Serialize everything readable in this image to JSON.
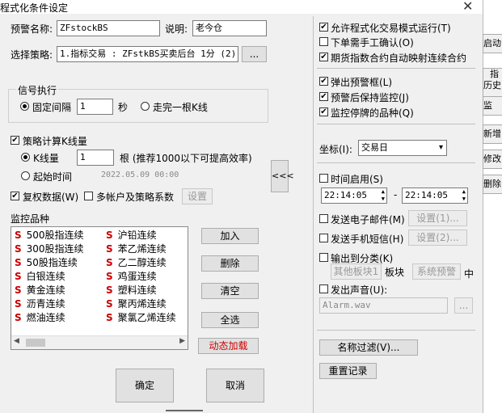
{
  "window": {
    "title": "程式化条件设定",
    "close_symbol": "✕"
  },
  "fields": {
    "alert_name_label": "预警名称:",
    "alert_name_value": "ZFstockBS",
    "desc_label": "说明:",
    "desc_value": "老今仓",
    "strategy_label": "选择策略:",
    "strategy_value": "1.指标交易 : ZFstkBS买卖后台 1分 (2)",
    "strategy_browse": "..."
  },
  "signal": {
    "group_label": "信号执行",
    "fixed_interval_label": "固定间隔",
    "fixed_interval_value": "1",
    "seconds_unit": "秒",
    "bar_complete_label": "走完一根K线"
  },
  "calc": {
    "strategy_kbars_label": "策略计算K线量",
    "kbars_label": "K线量",
    "kbars_value": "1",
    "kbars_hint": "根 (推荐1000以下可提高效率)",
    "start_time_label": "起始时间",
    "start_time_value": "2022.05.09 00:00:00",
    "adjusted_data_label": "复权数据(W)",
    "multi_account_label": "多帐户及策略系数",
    "settings_button": "设置"
  },
  "collapse_button": "<<<",
  "monitor": {
    "label": "监控品种",
    "s_marker": "S",
    "items_left": [
      "500股指连续",
      "300股指连续",
      "50股指连续",
      "白银连续",
      "黄金连续",
      "沥青连续",
      "燃油连续"
    ],
    "items_right": [
      "沪铅连续",
      "苯乙烯连续",
      "乙二醇连续",
      "鸡蛋连续",
      "塑料连续",
      "聚丙烯连续",
      "聚氯乙烯连续"
    ],
    "add_button": "加入",
    "delete_button": "删除",
    "clear_button": "清空",
    "select_all_button": "全选",
    "dynamic_load_button": "动态加载",
    "scroll_left": "◀",
    "scroll_right": "▶"
  },
  "bottom": {
    "ok_button": "确定",
    "cancel_button": "取消"
  },
  "right": {
    "allow_auto_trade": "允许程式化交易模式运行(T)",
    "manual_confirm": "下单需手工确认(O)",
    "futures_map": "期货指数合约自动映射连续合约",
    "popup_alert": "弹出预警框(L)",
    "keep_monitor": "预警后保持监控(J)",
    "monitor_suspended": "监控停牌的品种(Q)",
    "coord_label": "坐标(I):",
    "coord_value": "交易日",
    "time_enable": "时间启用(S)",
    "time_from": "22:14:05",
    "time_to": "22:14:05",
    "time_dash": "-",
    "send_email": "发送电子邮件(M)",
    "email_settings": "设置(1)...",
    "send_sms": "发送手机短信(H)",
    "sms_settings": "设置(2)...",
    "output_category": "输出到分类(K)",
    "category_value": "其他板块1",
    "block_label": "板块",
    "system_alert": "系统预警",
    "mid_label": "中",
    "play_sound": "发出声音(U):",
    "sound_file": "Alarm.wav",
    "sound_browse": "...",
    "name_filter": "名称过滤(V)...",
    "reset_log": "重置记录"
  },
  "side": {
    "b1": "启动",
    "b2a": "指",
    "b2b": "历史",
    "b3": "监",
    "b4": "新增",
    "b5": "修改",
    "b6": "删除"
  },
  "checks": {
    "strategy_kbars": true,
    "adjusted_data": true,
    "multi_account": false,
    "allow_auto_trade": true,
    "manual_confirm": false,
    "futures_map": true,
    "popup_alert": true,
    "keep_monitor": true,
    "monitor_suspended": true,
    "time_enable": false,
    "send_email": false,
    "send_sms": false,
    "output_category": false,
    "play_sound": false
  },
  "radios": {
    "signal_mode": "fixed_interval",
    "calc_mode": "kbars"
  },
  "colors": {
    "s_marker": "#cc0000",
    "dynamic_load": "#cc0000"
  }
}
